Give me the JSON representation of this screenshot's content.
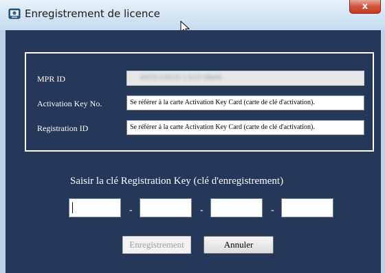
{
  "window": {
    "title": "Enregistrement de licence",
    "close_label": "x"
  },
  "form": {
    "mpr_id_label": "MPR ID",
    "mpr_id_value": "4K03-CDCD-13CD-5BA6",
    "activation_key_label": "Activation Key No.",
    "activation_key_value": "Se référer à la carte Activation Key Card (carte de clé d'activation).",
    "registration_id_label": "Registration ID",
    "registration_id_value": "Se référer à la carte Activation Key Card (carte de clé d'activation)."
  },
  "registration_key": {
    "prompt": "Saisir la clé Registration Key (clé d'enregistrement)",
    "separator": "-",
    "segments": [
      "",
      "",
      "",
      ""
    ]
  },
  "buttons": {
    "register_label": "Enregistrement",
    "cancel_label": "Annuler"
  }
}
